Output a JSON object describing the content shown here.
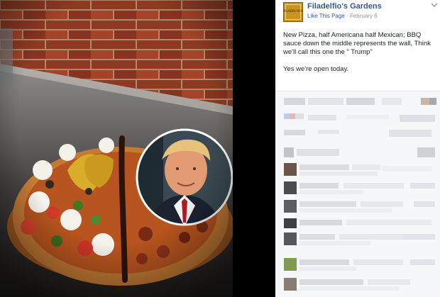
{
  "post": {
    "page_name": "Filadelfio's Gardens",
    "logo_text": "FILADELFIO'S",
    "like_link": "Like This Page",
    "separator": "·",
    "date": "February 6",
    "menu_icon": "chevron-down-icon",
    "text_line1": "New Pizza, half Americana half Mexican; BBQ sauce down the middle represents the wall, Think we'll call this one the \" Trump\"",
    "text_line2": "Yes we're open today."
  },
  "colors": {
    "link": "#365899",
    "meta": "#90949c",
    "body_text": "#1d2129",
    "logo_bg": "#c8961e"
  },
  "photo": {
    "subject": "pizza half Americana half Mexican with BBQ sauce line, inset portrait"
  }
}
